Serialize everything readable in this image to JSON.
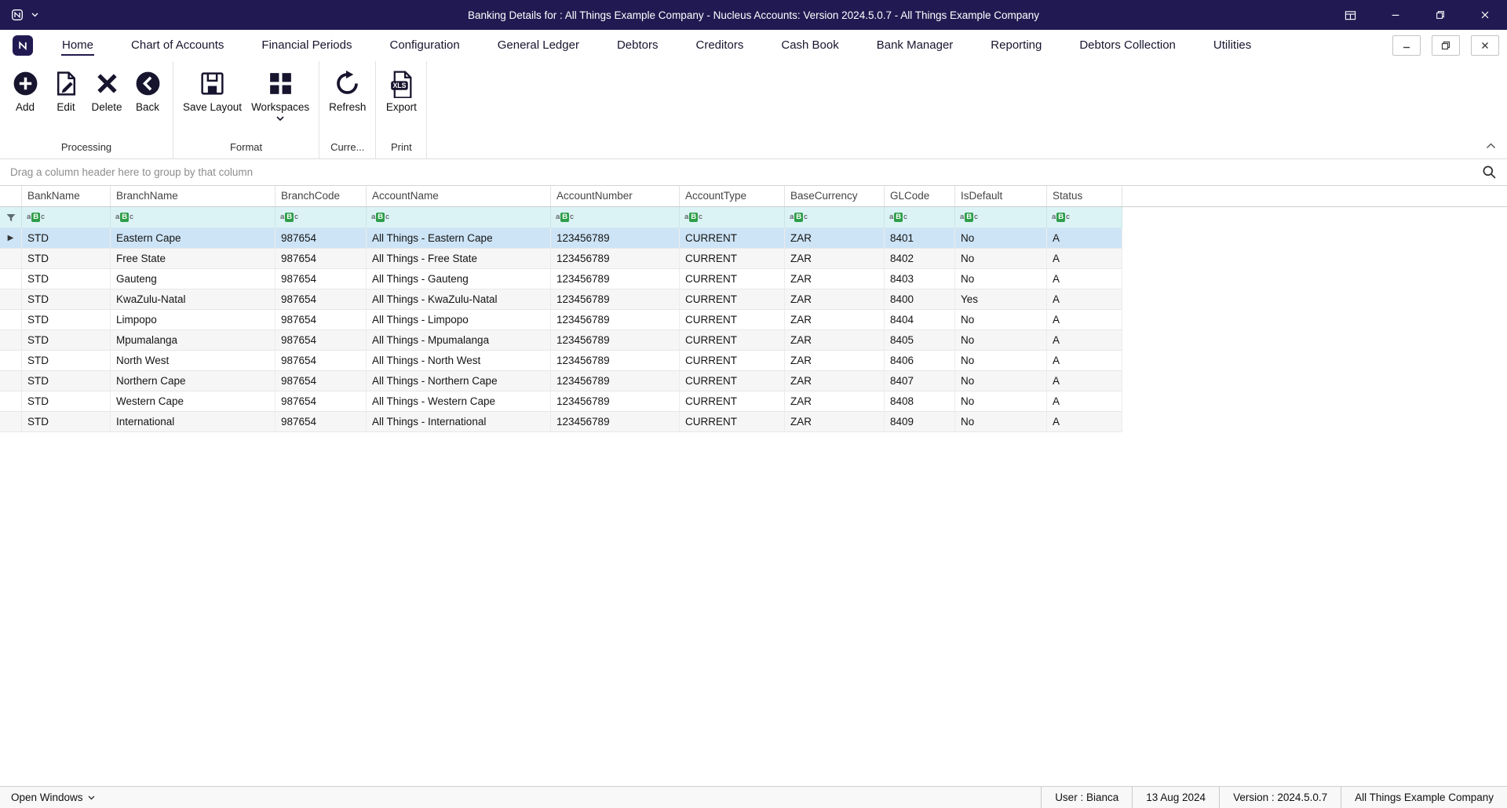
{
  "titlebar": {
    "title": "Banking Details for : All Things Example Company - Nucleus Accounts: Version 2024.5.0.7 - All Things Example Company"
  },
  "tabbar": {
    "active": "Home",
    "tabs": [
      "Home",
      "Chart of Accounts",
      "Financial Periods",
      "Configuration",
      "General Ledger",
      "Debtors",
      "Creditors",
      "Cash Book",
      "Bank Manager",
      "Reporting",
      "Debtors Collection",
      "Utilities"
    ]
  },
  "ribbon": {
    "groups": [
      {
        "label": "Processing",
        "buttons": [
          {
            "label": "Add",
            "icon": "add-icon"
          },
          {
            "label": "Edit",
            "icon": "edit-icon"
          },
          {
            "label": "Delete",
            "icon": "delete-icon"
          },
          {
            "label": "Back",
            "icon": "back-icon"
          }
        ]
      },
      {
        "label": "Format",
        "buttons": [
          {
            "label": "Save Layout",
            "icon": "save-layout-icon"
          },
          {
            "label": "Workspaces",
            "icon": "workspaces-icon",
            "dropdown": true
          }
        ]
      },
      {
        "label": "Curre...",
        "buttons": [
          {
            "label": "Refresh",
            "icon": "refresh-icon"
          }
        ]
      },
      {
        "label": "Print",
        "buttons": [
          {
            "label": "Export",
            "icon": "export-icon"
          }
        ]
      }
    ]
  },
  "grid": {
    "group_panel_text": "Drag a column header here to group by that column",
    "filter_icon_label": "aBc",
    "columns": [
      "BankName",
      "BranchName",
      "BranchCode",
      "AccountName",
      "AccountNumber",
      "AccountType",
      "BaseCurrency",
      "GLCode",
      "IsDefault",
      "Status"
    ],
    "selected_row_index": 0,
    "rows": [
      [
        "STD",
        "Eastern Cape",
        "987654",
        "All Things - Eastern Cape",
        "123456789",
        "CURRENT",
        "ZAR",
        "8401",
        "No",
        "A"
      ],
      [
        "STD",
        "Free State",
        "987654",
        "All Things - Free State",
        "123456789",
        "CURRENT",
        "ZAR",
        "8402",
        "No",
        "A"
      ],
      [
        "STD",
        "Gauteng",
        "987654",
        "All Things - Gauteng",
        "123456789",
        "CURRENT",
        "ZAR",
        "8403",
        "No",
        "A"
      ],
      [
        "STD",
        "KwaZulu-Natal",
        "987654",
        "All Things - KwaZulu-Natal",
        "123456789",
        "CURRENT",
        "ZAR",
        "8400",
        "Yes",
        "A"
      ],
      [
        "STD",
        "Limpopo",
        "987654",
        "All Things - Limpopo",
        "123456789",
        "CURRENT",
        "ZAR",
        "8404",
        "No",
        "A"
      ],
      [
        "STD",
        "Mpumalanga",
        "987654",
        "All Things - Mpumalanga",
        "123456789",
        "CURRENT",
        "ZAR",
        "8405",
        "No",
        "A"
      ],
      [
        "STD",
        "North West",
        "987654",
        "All Things - North West",
        "123456789",
        "CURRENT",
        "ZAR",
        "8406",
        "No",
        "A"
      ],
      [
        "STD",
        "Northern Cape",
        "987654",
        "All Things - Northern Cape",
        "123456789",
        "CURRENT",
        "ZAR",
        "8407",
        "No",
        "A"
      ],
      [
        "STD",
        "Western Cape",
        "987654",
        "All Things - Western Cape",
        "123456789",
        "CURRENT",
        "ZAR",
        "8408",
        "No",
        "A"
      ],
      [
        "STD",
        "International",
        "987654",
        "All Things - International",
        "123456789",
        "CURRENT",
        "ZAR",
        "8409",
        "No",
        "A"
      ]
    ]
  },
  "statusbar": {
    "open_windows_label": "Open Windows",
    "user": "User : Bianca",
    "date": "13 Aug 2024",
    "version": "Version : 2024.5.0.7",
    "company": "All Things Example Company"
  },
  "colors": {
    "titlebar_bg": "#211a52",
    "accent_navy": "#221a4f",
    "icon_navy": "#17142e",
    "filter_row_bg": "#dcf3f6",
    "selected_row_bg": "#cde4f6",
    "filter_badge_green": "#2e9e49"
  }
}
